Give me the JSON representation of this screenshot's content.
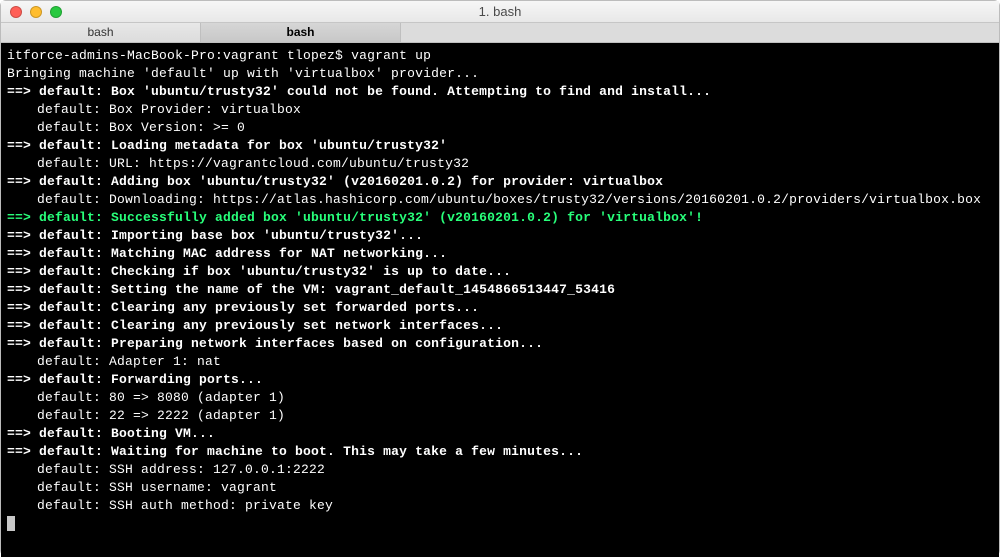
{
  "window": {
    "title": "1. bash",
    "tabs": [
      "bash",
      "bash"
    ],
    "activeTab": 1
  },
  "prompt": {
    "host": "itforce-admins-MacBook-Pro:vagrant tlopez$ ",
    "command": "vagrant up"
  },
  "lines": [
    {
      "type": "plain",
      "text": "Bringing machine 'default' up with 'virtualbox' provider..."
    },
    {
      "type": "arrow",
      "text": "default: Box 'ubuntu/trusty32' could not be found. Attempting to find and install..."
    },
    {
      "type": "sub",
      "text": "default: Box Provider: virtualbox"
    },
    {
      "type": "sub",
      "text": "default: Box Version: >= 0"
    },
    {
      "type": "arrow",
      "text": "default: Loading metadata for box 'ubuntu/trusty32'"
    },
    {
      "type": "sub",
      "text": "default: URL: https://vagrantcloud.com/ubuntu/trusty32"
    },
    {
      "type": "arrow",
      "text": "default: Adding box 'ubuntu/trusty32' (v20160201.0.2) for provider: virtualbox"
    },
    {
      "type": "sub",
      "text": "default: Downloading: https://atlas.hashicorp.com/ubuntu/boxes/trusty32/versions/20160201.0.2/providers/virtualbox.box"
    },
    {
      "type": "green",
      "text": "default: Successfully added box 'ubuntu/trusty32' (v20160201.0.2) for 'virtualbox'!"
    },
    {
      "type": "arrow",
      "text": "default: Importing base box 'ubuntu/trusty32'..."
    },
    {
      "type": "arrow",
      "text": "default: Matching MAC address for NAT networking..."
    },
    {
      "type": "arrow",
      "text": "default: Checking if box 'ubuntu/trusty32' is up to date..."
    },
    {
      "type": "arrow",
      "text": "default: Setting the name of the VM: vagrant_default_1454866513447_53416"
    },
    {
      "type": "arrow",
      "text": "default: Clearing any previously set forwarded ports..."
    },
    {
      "type": "arrow",
      "text": "default: Clearing any previously set network interfaces..."
    },
    {
      "type": "arrow",
      "text": "default: Preparing network interfaces based on configuration..."
    },
    {
      "type": "sub",
      "text": "default: Adapter 1: nat"
    },
    {
      "type": "arrow",
      "text": "default: Forwarding ports..."
    },
    {
      "type": "sub",
      "text": "default: 80 => 8080 (adapter 1)"
    },
    {
      "type": "sub",
      "text": "default: 22 => 2222 (adapter 1)"
    },
    {
      "type": "arrow",
      "text": "default: Booting VM..."
    },
    {
      "type": "arrow",
      "text": "default: Waiting for machine to boot. This may take a few minutes..."
    },
    {
      "type": "sub",
      "text": "default: SSH address: 127.0.0.1:2222"
    },
    {
      "type": "sub",
      "text": "default: SSH username: vagrant"
    },
    {
      "type": "sub",
      "text": "default: SSH auth method: private key"
    }
  ]
}
